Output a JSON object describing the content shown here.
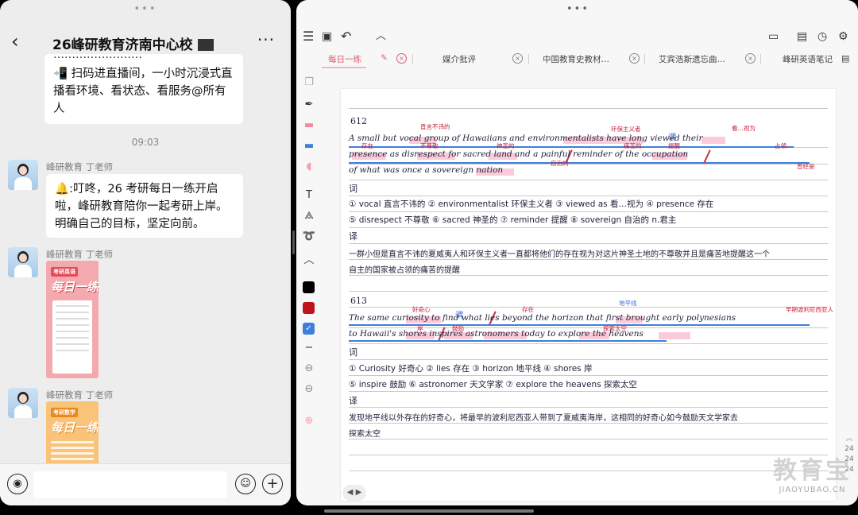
{
  "chat": {
    "title": "26峰研教育济南中心校",
    "back_icon": "‹",
    "more_icon": "···",
    "msg1_cut": "……………………",
    "msg1_icon": "📲",
    "msg1": "扫码进直播间，一小时沉浸式直播看环境、看状态、看服务@所有人",
    "time": "09:03",
    "sender": "峰研教育 丁老师",
    "msg2_icon": "🔔",
    "msg2": ":叮咚，26 考研每日一练开启啦，峰研教育陪你一起考研上岸。明确自己的目标，坚定向前。",
    "card1_tag": "考研英语",
    "card1_big": "每日一练",
    "card2_tag": "考研数学",
    "card2_big": "每日一练",
    "input_placeholder": ""
  },
  "notes": {
    "tabs": [
      {
        "label": "每日一练",
        "active": true
      },
      {
        "label": "媒介批评"
      },
      {
        "label": "中国教育史教材…"
      },
      {
        "label": "艾宾浩斯遗忘曲…"
      },
      {
        "label": "峰研英语笔记"
      }
    ],
    "page_numbers": [
      "24",
      "24",
      "24"
    ],
    "watermark_cn": "教育宝",
    "watermark_en": "JIAOYUBAO.CN",
    "sec1": {
      "num": "612",
      "line1": "A  small  but  vocal  group  of  Hawaiians  and  environmentalists  have  long  viewed  their",
      "line2": "presence  as  disrespect  for  sacred  land  and  a  painful  reminder  of  the  occupation",
      "line3": "of  what  was  once  a  sovereign  nation",
      "label_vocab": "词",
      "vocab1": "① vocal 直言不讳的    ② environmentalist 环保主义者    ③ viewed as 看…视为    ④ presence 存在",
      "vocab2": "⑤ disrespect 不尊敬    ⑥ sacred 神圣的    ⑦ reminder 提醒    ⑧ sovereign 自治的 n.君主",
      "label_trans": "译",
      "trans1": "一群小但是直言不讳的夏威夷人和环保主义者一直都将他们的存在视为对这片神圣土地的不尊敬并且是痛苦地提醒这一个",
      "trans2": "自主的国家被占领的痛苦的提醒",
      "ann": [
        "直言不讳的",
        "环保主义者",
        "看…视为",
        "存在",
        "不尊敬",
        "神圣的",
        "痛苦的",
        "提醒",
        "占领",
        "自治的",
        "曾经是",
        "谓"
      ]
    },
    "sec2": {
      "num": "613",
      "line1": "The  same  curiosity  to  find  what  lies  beyond  the  horizon  that  first  brought  early  polynesians",
      "line2": "to  Hawaii's  shores  inspires  astronomers  today  to  explore  the  heavens",
      "label_vocab": "词",
      "vocab1": "① Curiosity 好奇心    ② lies 存在    ③ horizon 地平线    ④ shores 岸",
      "vocab2": "⑤ inspire 鼓励    ⑥ astronomer 天文学家    ⑦ explore the heavens 探索太空",
      "label_trans": "译",
      "trans1": "发现地平线以外存在的好奇心，将最早的波利尼西亚人带到了夏威夷海岸，这相同的好奇心如今鼓励天文学家去",
      "trans2": "探索太空",
      "ann": [
        "好奇心",
        "存在",
        "地平线",
        "谓",
        "岸",
        "鼓励",
        "探索太空",
        "早期波利尼西亚人"
      ]
    }
  },
  "colors": {
    "accent": "#e05a6d",
    "highlight": "#f58caa",
    "ink_red": "#c8203a",
    "ink_blue": "#3c6fd6"
  }
}
